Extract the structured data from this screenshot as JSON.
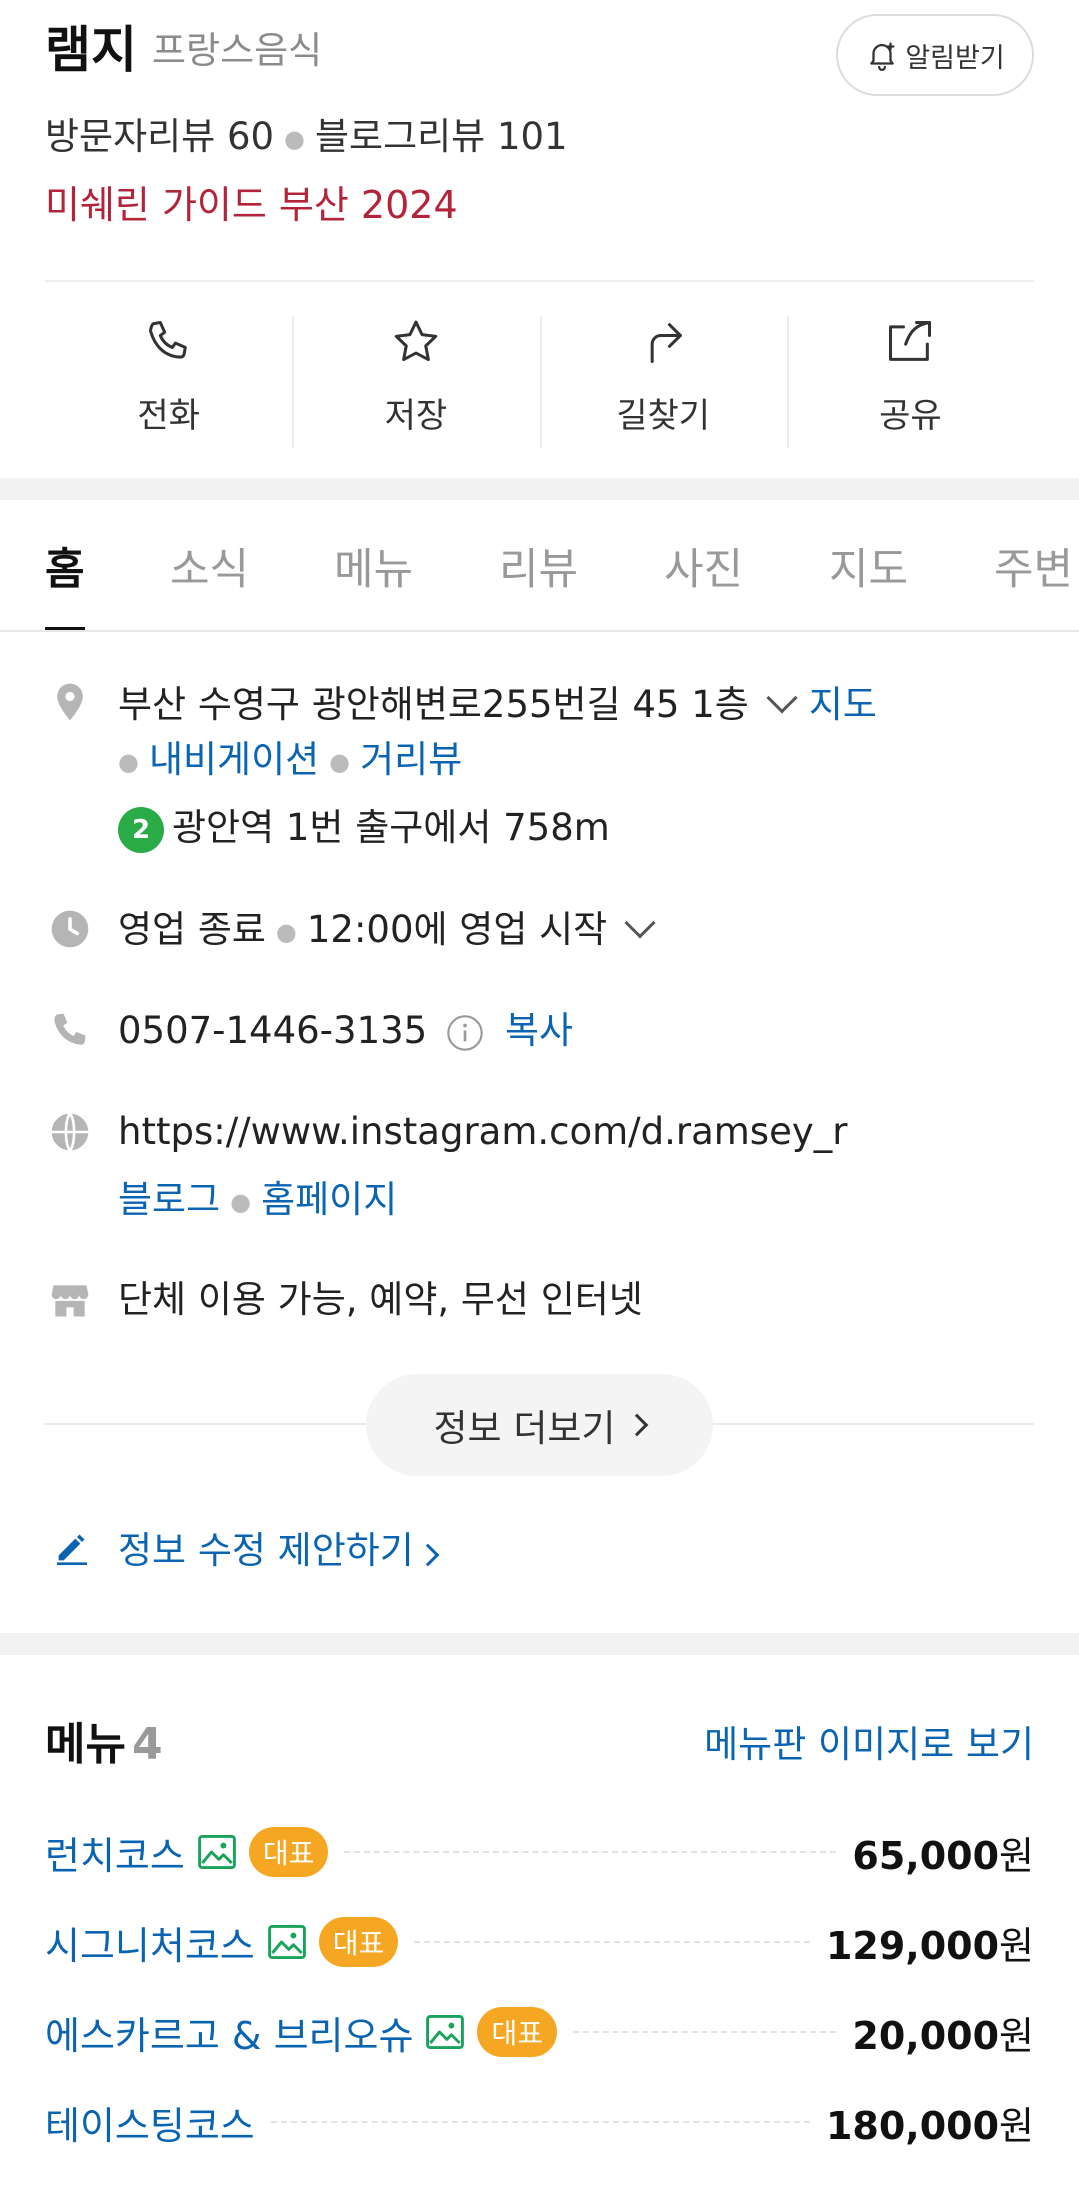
{
  "header": {
    "title": "램지",
    "category": "프랑스음식",
    "alarm_label": "알림받기",
    "visitor_reviews": "방문자리뷰 60",
    "blog_reviews": "블로그리뷰 101",
    "michelin": "미쉐린 가이드 부산 2024"
  },
  "actions": [
    {
      "label": "전화",
      "icon": "phone-icon"
    },
    {
      "label": "저장",
      "icon": "star-icon"
    },
    {
      "label": "길찾기",
      "icon": "directions-icon"
    },
    {
      "label": "공유",
      "icon": "share-icon"
    }
  ],
  "tabs": [
    "홈",
    "소식",
    "메뉴",
    "리뷰",
    "사진",
    "지도",
    "주변"
  ],
  "info": {
    "address": "부산 수영구 광안해변로255번길 45 1층",
    "map_link": "지도",
    "navigation_link": "내비게이션",
    "streetview_link": "거리뷰",
    "subway_line": "2",
    "subway_text": "광안역 1번 출구에서 758m",
    "hours_status": "영업 종료",
    "hours_text": "12:00에 영업 시작",
    "phone": "0507-1446-3135",
    "copy_label": "복사",
    "website": "https://www.instagram.com/d.ramsey_r",
    "blog_link": "블로그",
    "homepage_link": "홈페이지",
    "amenities": "단체 이용 가능, 예약, 무선 인터넷",
    "more_label": "정보 더보기",
    "suggest_label": "정보 수정 제안하기"
  },
  "menu": {
    "title": "메뉴",
    "count": "4",
    "board_link": "메뉴판 이미지로 보기",
    "badge_label": "대표",
    "items": [
      {
        "name": "런치코스",
        "price": "65,000",
        "unit": "원",
        "has_image": true,
        "featured": true
      },
      {
        "name": "시그니처코스",
        "price": "129,000",
        "unit": "원",
        "has_image": true,
        "featured": true
      },
      {
        "name": "에스카르고 & 브리오슈",
        "price": "20,000",
        "unit": "원",
        "has_image": true,
        "featured": true
      },
      {
        "name": "테이스팅코스",
        "price": "180,000",
        "unit": "원",
        "has_image": false,
        "featured": false
      }
    ]
  },
  "colors": {
    "link": "#0b64b2",
    "michelin": "#b3243a",
    "badge": "#f5a623",
    "subway_line_2": "#2aab45"
  }
}
